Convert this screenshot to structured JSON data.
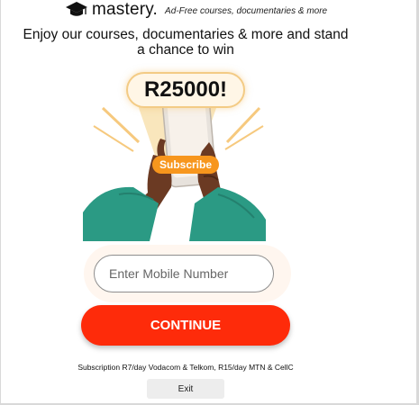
{
  "brand": {
    "name": "mastery.",
    "tagline": "Ad-Free courses, documentaries & more",
    "logo_icon": "graduation-cap-icon"
  },
  "headline": {
    "line1": "Enjoy our courses, documentaries & more and stand",
    "line2": "a chance to win"
  },
  "hero": {
    "prize": "R25000!",
    "subscribe_label": "Subscribe"
  },
  "form": {
    "mobile_placeholder": "Enter Mobile Number",
    "mobile_value": "",
    "continue_label": "CONTINUE"
  },
  "terms": "Subscription R7/day Vodacom & Telkom, R15/day MTN & CellC",
  "exit_label": "Exit",
  "colors": {
    "continue_button": "#fe2b0a",
    "subscribe_pill": "#f7961d",
    "sleeve": "#2b9a84",
    "skin": "#6b3a23",
    "glow": "#f7d797"
  }
}
